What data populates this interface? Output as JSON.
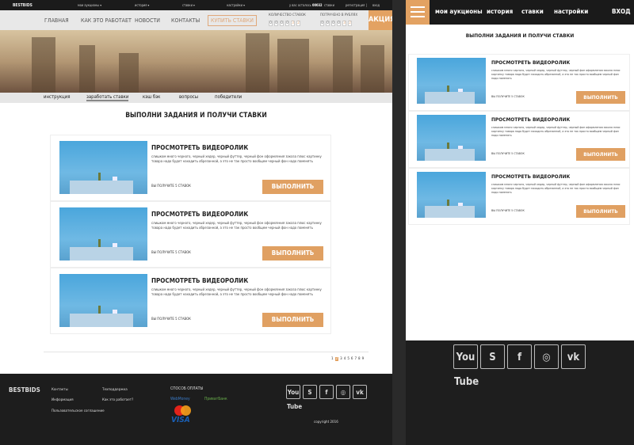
{
  "colors": {
    "accent": "#e3a262",
    "dark": "#1b1b1b"
  },
  "desktop": {
    "topbar": {
      "logo": "BESTBIDS",
      "menu": [
        "мои аукционы ▾",
        "история ▾",
        "ставки ▾",
        "настройки ▾"
      ],
      "remaining_prefix": "у вас осталось",
      "remaining_value": "00032",
      "remaining_suffix": "ставки",
      "register": "регистрация",
      "separator": "|",
      "login": "вход"
    },
    "nav": {
      "items": [
        "ГЛАВНАЯ",
        "КАК ЭТО РАБОТАЕТ",
        "НОВОСТИ",
        "КОНТАКТЫ"
      ],
      "buy": "КУПИТЬ СТАВКИ",
      "bids_label": "КОЛИЧЕСТВО СТАВОК",
      "bids_digits": [
        "0",
        "0",
        "0",
        "0",
        "3",
        "2"
      ],
      "spent_label": "ПОТРАЧЕНО В РУБЛЯХ",
      "spent_digits": [
        "0",
        "0",
        "0",
        "0",
        "3",
        "2"
      ],
      "promo": "АКЦИЯ"
    },
    "subnav": {
      "items": [
        "инструкция",
        "заработать ставки",
        "кэш бэк",
        "вопросы",
        "победители"
      ],
      "active": 1
    },
    "title": "ВЫПОЛНИ ЗАДАНИЯ И ПОЛУЧИ СТАВКИ",
    "tasks": [
      {
        "heading": "ПРОСМОТРЕТЬ ВИДЕОРОЛИК",
        "desc": "слишком много черного, черный хедер, черный футтер, черный фон оформления заказа плюс картинку товара надо будет находить обрезанной, а это не так просто вообщем черный фон надо поменять",
        "reward": "ВЫ ПОЛУЧИТЕ 5 СТАВОК",
        "button": "ВЫПОЛНИТЬ"
      },
      {
        "heading": "ПРОСМОТРЕТЬ ВИДЕОРОЛИК",
        "desc": "слишком много черного, черный хедер, черный футтер, черный фон оформления заказа плюс картинку товара надо будет находить обрезанной, а это не так просто вообщем черный фон надо поменять",
        "reward": "ВЫ ПОЛУЧИТЕ 5 СТАВОК",
        "button": "ВЫПОЛНИТЬ"
      },
      {
        "heading": "ПРОСМОТРЕТЬ ВИДЕОРОЛИК",
        "desc": "слишком много черного, черный хедер, черный футтер, черный фон оформления заказа плюс картинку товара надо будет находить обрезанной, а это не так просто вообщем черный фон надо поменять",
        "reward": "ВЫ ПОЛУЧИТЕ 5 СТАВОК",
        "button": "ВЫПОЛНИТЬ"
      }
    ],
    "pagination": {
      "pages": [
        "1",
        "2",
        "3",
        "4",
        "5",
        "6",
        "7",
        "8",
        "9"
      ],
      "active": 1
    },
    "footer": {
      "logo": "BESTBIDS",
      "links_col1": [
        "Контакты",
        "Информация",
        "Пользовательское соглашение"
      ],
      "links_col2": [
        "Техподдержка",
        "Как это работает?"
      ],
      "payment_title": "СПОСОБ ОПЛАТЫ",
      "payments": [
        "WebMoney",
        "ПриватБанк",
        "MasterCard",
        "VISA"
      ],
      "social": [
        "youtube-icon",
        "skype-icon",
        "facebook-icon",
        "instagram-icon",
        "vk-icon"
      ],
      "copyright": "copyright 2016"
    }
  },
  "mobile": {
    "nav": {
      "items": [
        "мои аукционы",
        "история",
        "ставки",
        "настройки"
      ],
      "login": "ВХОД"
    },
    "title": "ВЫПОЛНИ ЗАДАНИЯ И ПОЛУЧИ СТАВКИ"
  }
}
